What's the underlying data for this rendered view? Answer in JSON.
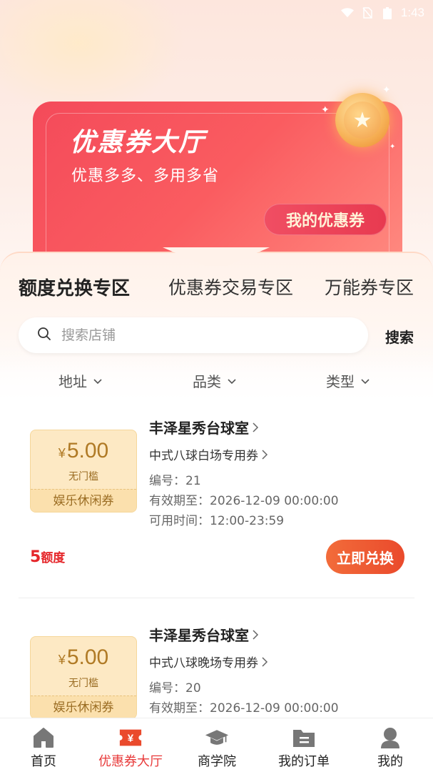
{
  "status_bar": {
    "time": "1:43"
  },
  "banner": {
    "title": "优惠券大厅",
    "subtitle": "优惠多多、多用多省",
    "my_coupon_label": "我的优惠券"
  },
  "tabs": [
    {
      "label": "额度兑换专区",
      "active": true
    },
    {
      "label": "优惠券交易专区",
      "active": false
    },
    {
      "label": "万能券专区",
      "active": false
    }
  ],
  "search": {
    "placeholder": "搜索店铺",
    "button_label": "搜索"
  },
  "filters": [
    {
      "label": "地址"
    },
    {
      "label": "品类"
    },
    {
      "label": "类型"
    }
  ],
  "coupons": [
    {
      "currency": "¥",
      "amount": "5.00",
      "threshold": "无门槛",
      "type": "娱乐休闲券",
      "store_name": "丰泽星秀台球室",
      "coupon_name": "中式八球白场专用券",
      "number_label": "编号：",
      "number": "21",
      "expiry_label": "有效期至：",
      "expiry": "2026-12-09 00:00:00",
      "available_label": "可用时间：",
      "available": "12:00-23:59",
      "credit_amount": "5",
      "credit_unit": "额度",
      "redeem_label": "立即兑换"
    },
    {
      "currency": "¥",
      "amount": "5.00",
      "threshold": "无门槛",
      "type": "娱乐休闲券",
      "store_name": "丰泽星秀台球室",
      "coupon_name": "中式八球晚场专用券",
      "number_label": "编号：",
      "number": "20",
      "expiry_label": "有效期至：",
      "expiry": "2026-12-09 00:00:00"
    }
  ],
  "bottom_nav": [
    {
      "label": "首页",
      "icon": "home-icon",
      "active": false
    },
    {
      "label": "优惠券大厅",
      "icon": "coupon-icon",
      "active": true
    },
    {
      "label": "商学院",
      "icon": "graduation-cap-icon",
      "active": false
    },
    {
      "label": "我的订单",
      "icon": "order-folder-icon",
      "active": false
    },
    {
      "label": "我的",
      "icon": "user-icon",
      "active": false
    }
  ],
  "colors": {
    "accent": "#e83a3a",
    "banner": "#f44a5a",
    "coupon_bg": "#fde9c4",
    "coupon_text": "#b07a25",
    "redeem_button": "#ea4a2c"
  }
}
